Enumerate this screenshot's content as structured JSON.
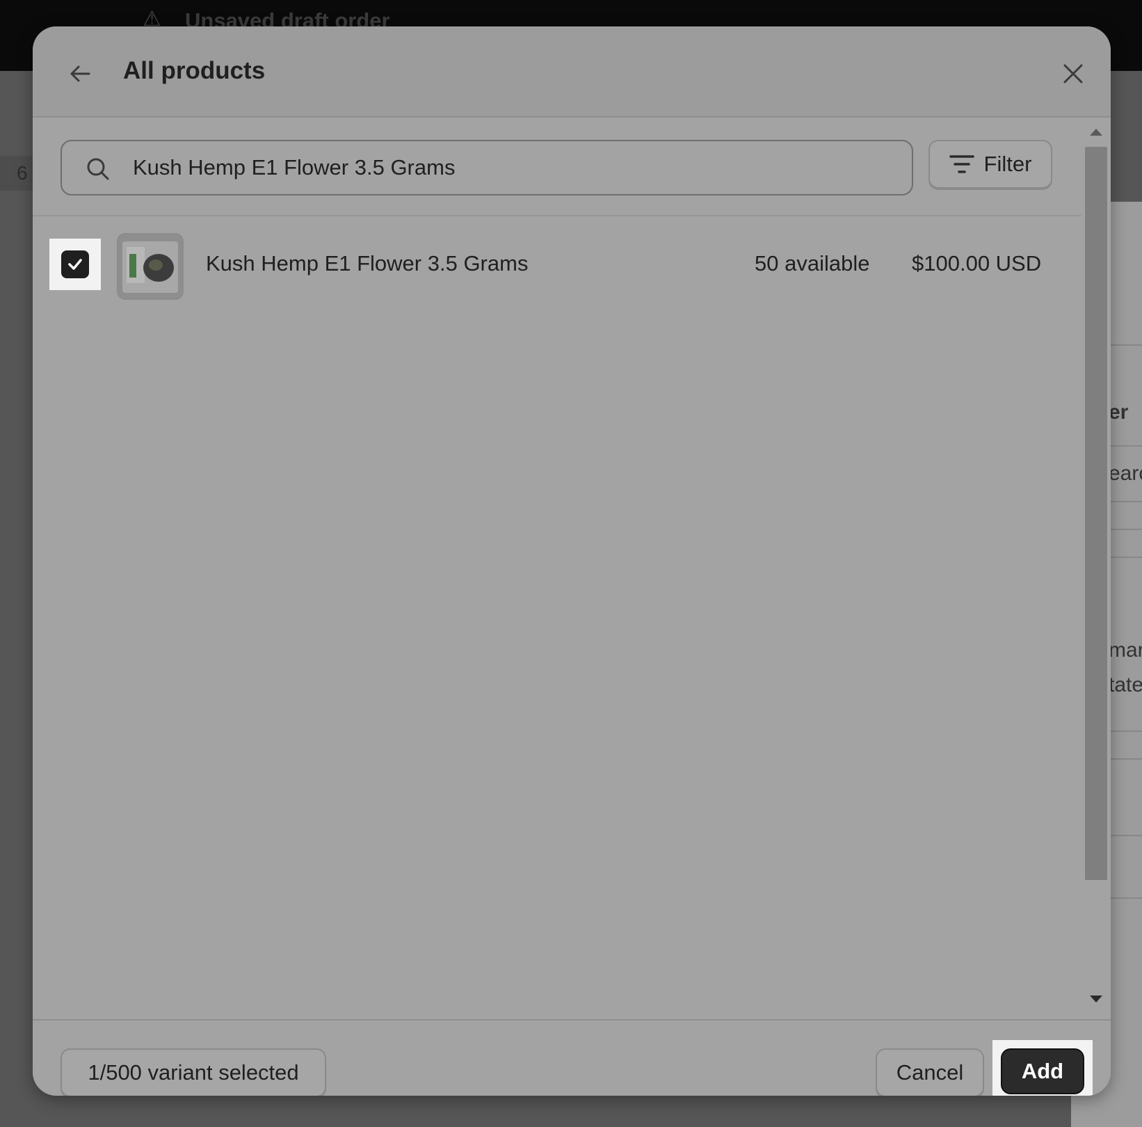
{
  "background": {
    "draft_title": "Unsaved draft order",
    "chip_text": "6",
    "right_texts": [
      "er",
      "earc",
      "mar",
      "tate"
    ]
  },
  "modal": {
    "title": "All products",
    "back_icon": "arrow-left-icon",
    "close_icon": "close-icon"
  },
  "search": {
    "value": "Kush Hemp E1 Flower 3.5 Grams",
    "icon": "search-icon"
  },
  "filter": {
    "label": "Filter",
    "icon": "filter-lines-icon"
  },
  "products": [
    {
      "name": "Kush Hemp E1 Flower 3.5 Grams",
      "available": "50 available",
      "price": "$100.00 USD",
      "checked": true
    }
  ],
  "footer": {
    "variant_selected": "1/500 variant selected",
    "cancel_label": "Cancel",
    "add_label": "Add"
  }
}
